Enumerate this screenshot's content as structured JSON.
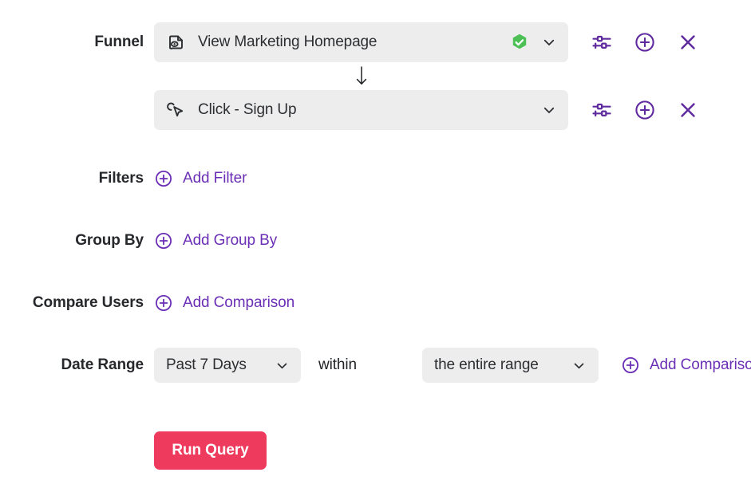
{
  "accent": {
    "purple": "#6a2fb5",
    "purple_dark": "#5f2a9e",
    "green": "#4cc054",
    "red": "#ee3a5d",
    "field_bg": "#ededed",
    "text": "#1f2124"
  },
  "funnel": {
    "label": "Funnel",
    "steps": [
      {
        "icon": "page-view-icon",
        "text": "View Marketing Homepage",
        "verified": true,
        "verified_icon": "verified-check-badge-icon",
        "chevron_icon": "chevron-down-icon",
        "actions": [
          {
            "name": "filter-settings-icon",
            "label": "Filter settings"
          },
          {
            "name": "add-step-icon",
            "label": "Add step"
          },
          {
            "name": "remove-step-icon",
            "label": "Remove step"
          }
        ]
      },
      {
        "icon": "click-cursor-icon",
        "text": "Click - Sign Up",
        "verified": false,
        "verified_icon": "",
        "chevron_icon": "chevron-down-icon",
        "actions": [
          {
            "name": "filter-settings-icon",
            "label": "Filter settings"
          },
          {
            "name": "add-step-icon",
            "label": "Add step"
          },
          {
            "name": "remove-step-icon",
            "label": "Remove step"
          }
        ]
      }
    ],
    "connector_icon": "arrow-down-icon"
  },
  "filters": {
    "label": "Filters",
    "add_label": "Add Filter",
    "add_icon": "plus-circle-icon"
  },
  "group_by": {
    "label": "Group By",
    "add_label": "Add Group By",
    "add_icon": "plus-circle-icon"
  },
  "compare_users": {
    "label": "Compare Users",
    "add_label": "Add Comparison",
    "add_icon": "plus-circle-icon"
  },
  "date_range": {
    "label": "Date Range",
    "range_value": "Past 7 Days",
    "range_chevron_icon": "chevron-down-icon",
    "conjunction": "within",
    "scope_value": "the entire range",
    "scope_chevron_icon": "chevron-down-icon",
    "add_label": "Add Comparison",
    "add_icon": "plus-circle-icon"
  },
  "run": {
    "label": "Run Query"
  }
}
